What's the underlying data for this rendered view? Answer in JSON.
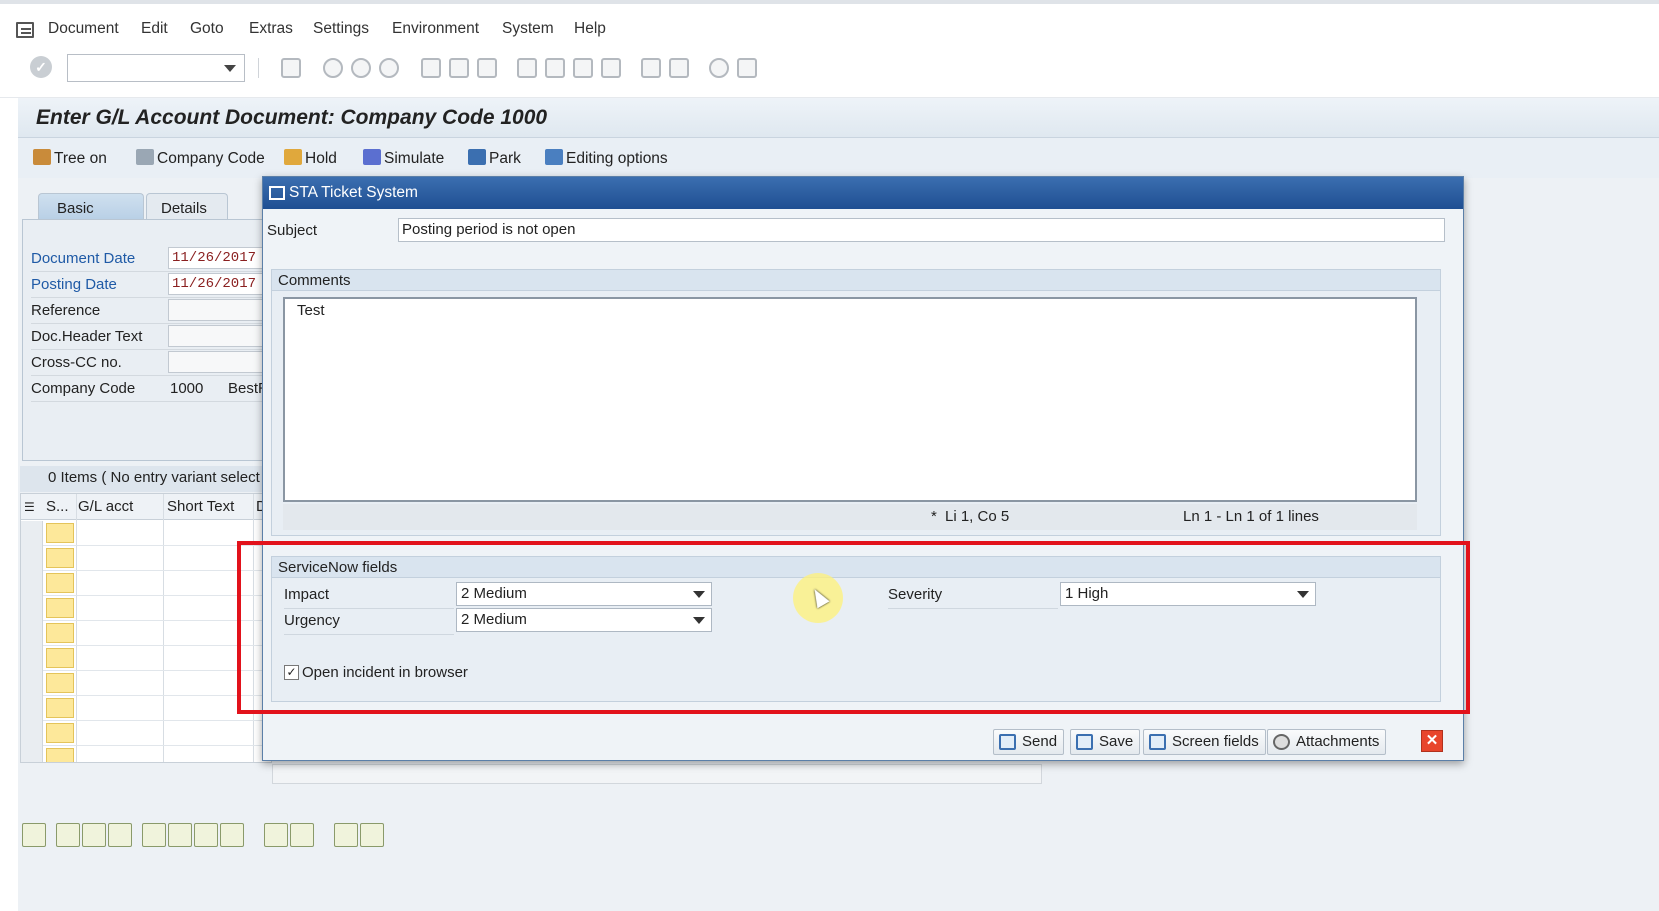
{
  "menu": [
    "Document",
    "Edit",
    "Goto",
    "Extras",
    "Settings",
    "Environment",
    "System",
    "Help"
  ],
  "title": "Enter G/L Account Document: Company Code 1000",
  "app_toolbar": {
    "tree_on": "Tree on",
    "company_code": "Company Code",
    "hold": "Hold",
    "simulate": "Simulate",
    "park": "Park",
    "editing_options": "Editing options"
  },
  "tabs": [
    "Basic Data",
    "Details"
  ],
  "header_fields": {
    "document_date": {
      "label": "Document Date",
      "value": "11/26/2017"
    },
    "posting_date": {
      "label": "Posting Date",
      "value": "11/26/2017"
    },
    "reference": {
      "label": "Reference",
      "value": ""
    },
    "doc_header_text": {
      "label": "Doc.Header Text",
      "value": ""
    },
    "cross_cc": {
      "label": "Cross-CC no.",
      "value": ""
    },
    "company_code": {
      "label": "Company Code",
      "value": "1000",
      "name": "BestR"
    }
  },
  "items": {
    "summary": "0 Items ( No entry variant select",
    "columns": [
      "S...",
      "G/L acct",
      "Short Text",
      "D"
    ]
  },
  "dialog": {
    "title": "STA Ticket System",
    "subject_label": "Subject",
    "subject_value": "Posting period is not open",
    "comments_label": "Comments",
    "comments_text": "Test",
    "status_marker": "*",
    "status_cursor": "Li 1, Co 5",
    "status_lines": "Ln 1 - Ln 1 of 1 lines",
    "servicenow_label": "ServiceNow fields",
    "impact_label": "Impact",
    "impact_value": "2 Medium",
    "urgency_label": "Urgency",
    "urgency_value": "2 Medium",
    "severity_label": "Severity",
    "severity_value": "1 High",
    "open_browser_label": "Open incident in browser",
    "open_browser_checked": "✓",
    "buttons": {
      "send": "Send",
      "save": "Save",
      "screen_fields": "Screen fields",
      "attachments": "Attachments",
      "close": "✕"
    }
  },
  "colors": {
    "dialog_title_bar": "#2a5c9f",
    "highlight_box": "#e2121b",
    "required_label": "#1f5aa6",
    "date_value": "#8a1f1f"
  }
}
